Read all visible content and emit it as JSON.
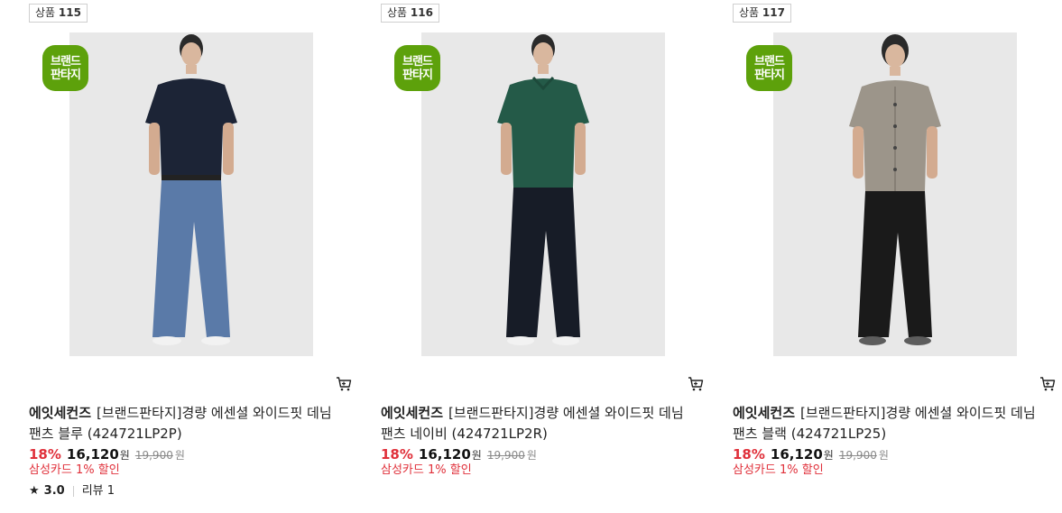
{
  "products": [
    {
      "badge_label": "상품",
      "badge_num": "115",
      "brand_logo": [
        "브랜드",
        "판타지"
      ],
      "brand": "에잇세컨즈",
      "name": "[브랜드판타지]경량 에센셜 와이드핏 데님 팬츠 블루 (424721LP2P)",
      "discount": "18%",
      "price": "16,120",
      "price_unit": "원",
      "original_price": "19,900",
      "original_unit": "원",
      "card_discount": "삼성카드 1% 할인",
      "rating": "3.0",
      "reviews": "리뷰 1",
      "colors": {
        "shirt": "#1c2436",
        "pants": "#5a7aa8"
      },
      "icon": "cart-icon"
    },
    {
      "badge_label": "상품",
      "badge_num": "116",
      "brand_logo": [
        "브랜드",
        "판타지"
      ],
      "brand": "에잇세컨즈",
      "name": "[브랜드판타지]경량 에센셜 와이드핏 데님 팬츠 네이비 (424721LP2R)",
      "discount": "18%",
      "price": "16,120",
      "price_unit": "원",
      "original_price": "19,900",
      "original_unit": "원",
      "card_discount": "삼성카드 1% 할인",
      "colors": {
        "shirt": "#245a48",
        "pants": "#171c27"
      },
      "icon": "cart-icon"
    },
    {
      "badge_label": "상품",
      "badge_num": "117",
      "brand_logo": [
        "브랜드",
        "판타지"
      ],
      "brand": "에잇세컨즈",
      "name": "[브랜드판타지]경량 에센셜 와이드핏 데님 팬츠 블랙 (424721LP25)",
      "discount": "18%",
      "price": "16,120",
      "price_unit": "원",
      "original_price": "19,900",
      "original_unit": "원",
      "card_discount": "삼성카드 1% 할인",
      "colors": {
        "shirt": "#9c958a",
        "pants": "#1a1a1a"
      },
      "icon": "cart-icon"
    }
  ],
  "theme": {
    "discount_color": "#e0303a",
    "brand_logo_bg": "#5da10b"
  }
}
